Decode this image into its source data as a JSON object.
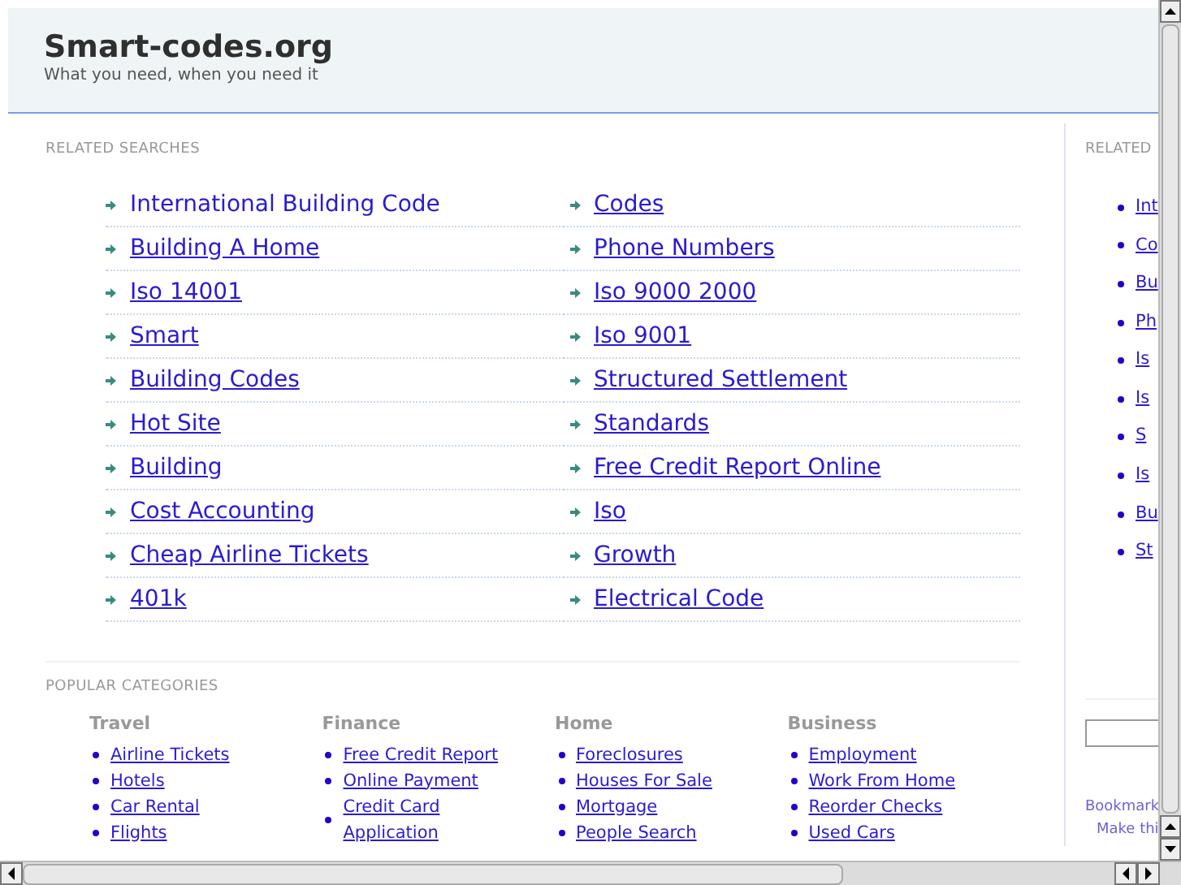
{
  "header": {
    "title": "Smart-codes.org",
    "tagline": "What you need, when you need it"
  },
  "related_searches": {
    "heading": "RELATED SEARCHES",
    "links": [
      {
        "label": "International Building Code",
        "hovered": true
      },
      {
        "label": "Codes",
        "hovered": false
      },
      {
        "label": "Building A Home",
        "hovered": false
      },
      {
        "label": "Phone Numbers",
        "hovered": false
      },
      {
        "label": "Iso 14001",
        "hovered": false
      },
      {
        "label": "Iso 9000 2000",
        "hovered": false
      },
      {
        "label": "Smart",
        "hovered": false
      },
      {
        "label": "Iso 9001",
        "hovered": false
      },
      {
        "label": "Building Codes",
        "hovered": false
      },
      {
        "label": "Structured Settlement",
        "hovered": false
      },
      {
        "label": "Hot Site",
        "hovered": false
      },
      {
        "label": "Standards",
        "hovered": false
      },
      {
        "label": "Building",
        "hovered": false
      },
      {
        "label": "Free Credit Report Online",
        "hovered": false
      },
      {
        "label": "Cost Accounting",
        "hovered": false
      },
      {
        "label": "Iso",
        "hovered": false
      },
      {
        "label": "Cheap Airline Tickets",
        "hovered": false
      },
      {
        "label": "Growth",
        "hovered": false
      },
      {
        "label": "401k",
        "hovered": false
      },
      {
        "label": "Electrical Code",
        "hovered": false
      }
    ]
  },
  "popular_categories": {
    "heading": "POPULAR CATEGORIES",
    "categories": [
      {
        "name": "Travel",
        "links": [
          "Airline Tickets",
          "Hotels",
          "Car Rental",
          "Flights"
        ]
      },
      {
        "name": "Finance",
        "links": [
          "Free Credit Report",
          "Online Payment",
          "Credit Card Application"
        ]
      },
      {
        "name": "Home",
        "links": [
          "Foreclosures",
          "Houses For Sale",
          "Mortgage",
          "People Search"
        ]
      },
      {
        "name": "Business",
        "links": [
          "Employment",
          "Work From Home",
          "Reorder Checks",
          "Used Cars"
        ]
      }
    ]
  },
  "sidebar": {
    "heading": "RELATED",
    "links": [
      "Int",
      "Co",
      "Bu",
      "Ph",
      "Is",
      "Is",
      "S",
      "Is",
      "Bu",
      "St"
    ],
    "bookmark": "Bookmark",
    "make": "Make thi"
  }
}
